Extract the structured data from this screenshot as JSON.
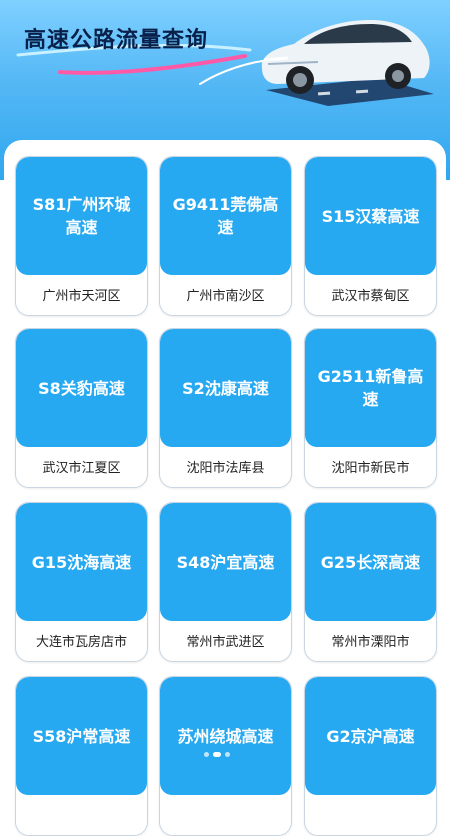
{
  "header": {
    "title": "高速公路流量查询"
  },
  "colors": {
    "banner": "#55b8f5",
    "card_accent": "#27a9f1",
    "title": "#08204a"
  },
  "cards": [
    {
      "name": "S81广州环城高速",
      "location": "广州市天河区"
    },
    {
      "name": "G9411莞佛高速",
      "location": "广州市南沙区"
    },
    {
      "name": "S15汉蔡高速",
      "location": "武汉市蔡甸区"
    },
    {
      "name": "S8关豹高速",
      "location": "武汉市江夏区"
    },
    {
      "name": "S2沈康高速",
      "location": "沈阳市法库县"
    },
    {
      "name": "G2511新鲁高速",
      "location": "沈阳市新民市"
    },
    {
      "name": "G15沈海高速",
      "location": "大连市瓦房店市"
    },
    {
      "name": "S48沪宜高速",
      "location": "常州市武进区"
    },
    {
      "name": "G25长深高速",
      "location": "常州市溧阳市"
    },
    {
      "name": "S58沪常高速",
      "location": ""
    },
    {
      "name": "苏州绕城高速",
      "location": ""
    },
    {
      "name": "G2京沪高速",
      "location": ""
    }
  ],
  "pager": {
    "count": 3,
    "active": 1
  },
  "icons": {
    "car": "car-icon"
  }
}
